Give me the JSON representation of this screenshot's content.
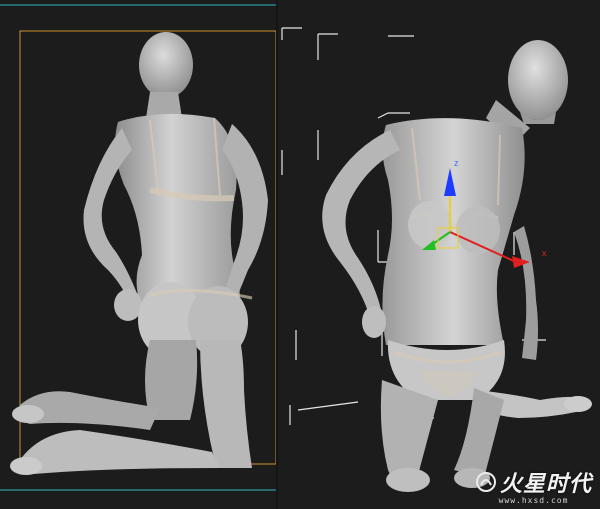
{
  "viewports": {
    "left": {
      "name": "left-viewport"
    },
    "right": {
      "name": "right-viewport"
    }
  },
  "colors": {
    "background": "#1c1c1c",
    "selection_box": "#c8952c",
    "cyan_frame": "#2fb6c4",
    "gizmo_x": "#e02020",
    "gizmo_y": "#20c020",
    "gizmo_z": "#1e3cff",
    "figure_skin": "#c9c9c9"
  },
  "gizmo": {
    "axis_x_label": "x",
    "axis_z_label": "z"
  },
  "watermark": {
    "title": "火星时代",
    "url": "www.hxsd.com"
  }
}
